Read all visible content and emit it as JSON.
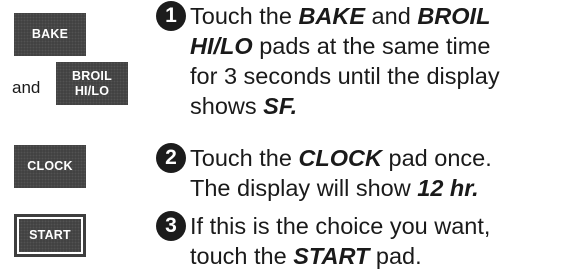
{
  "pads": {
    "bake": "BAKE",
    "broil_line1": "BROIL",
    "broil_line2": "HI/LO",
    "clock": "CLOCK",
    "start": "START",
    "and_text": "and"
  },
  "steps": [
    {
      "number": "1",
      "lines": [
        [
          "Touch the ",
          "BAKE",
          " and ",
          "BROIL"
        ],
        [
          "",
          "HI/LO",
          " pads at the same time"
        ],
        [
          "for 3 seconds until the display"
        ],
        [
          "shows ",
          "SF."
        ]
      ]
    },
    {
      "number": "2",
      "lines": [
        [
          "Touch the ",
          "CLOCK",
          " pad once."
        ],
        [
          "The display will show ",
          "12 hr."
        ]
      ]
    },
    {
      "number": "3",
      "lines": [
        [
          "If this is the choice you want,"
        ],
        [
          "touch the ",
          "START",
          " pad."
        ]
      ]
    }
  ]
}
